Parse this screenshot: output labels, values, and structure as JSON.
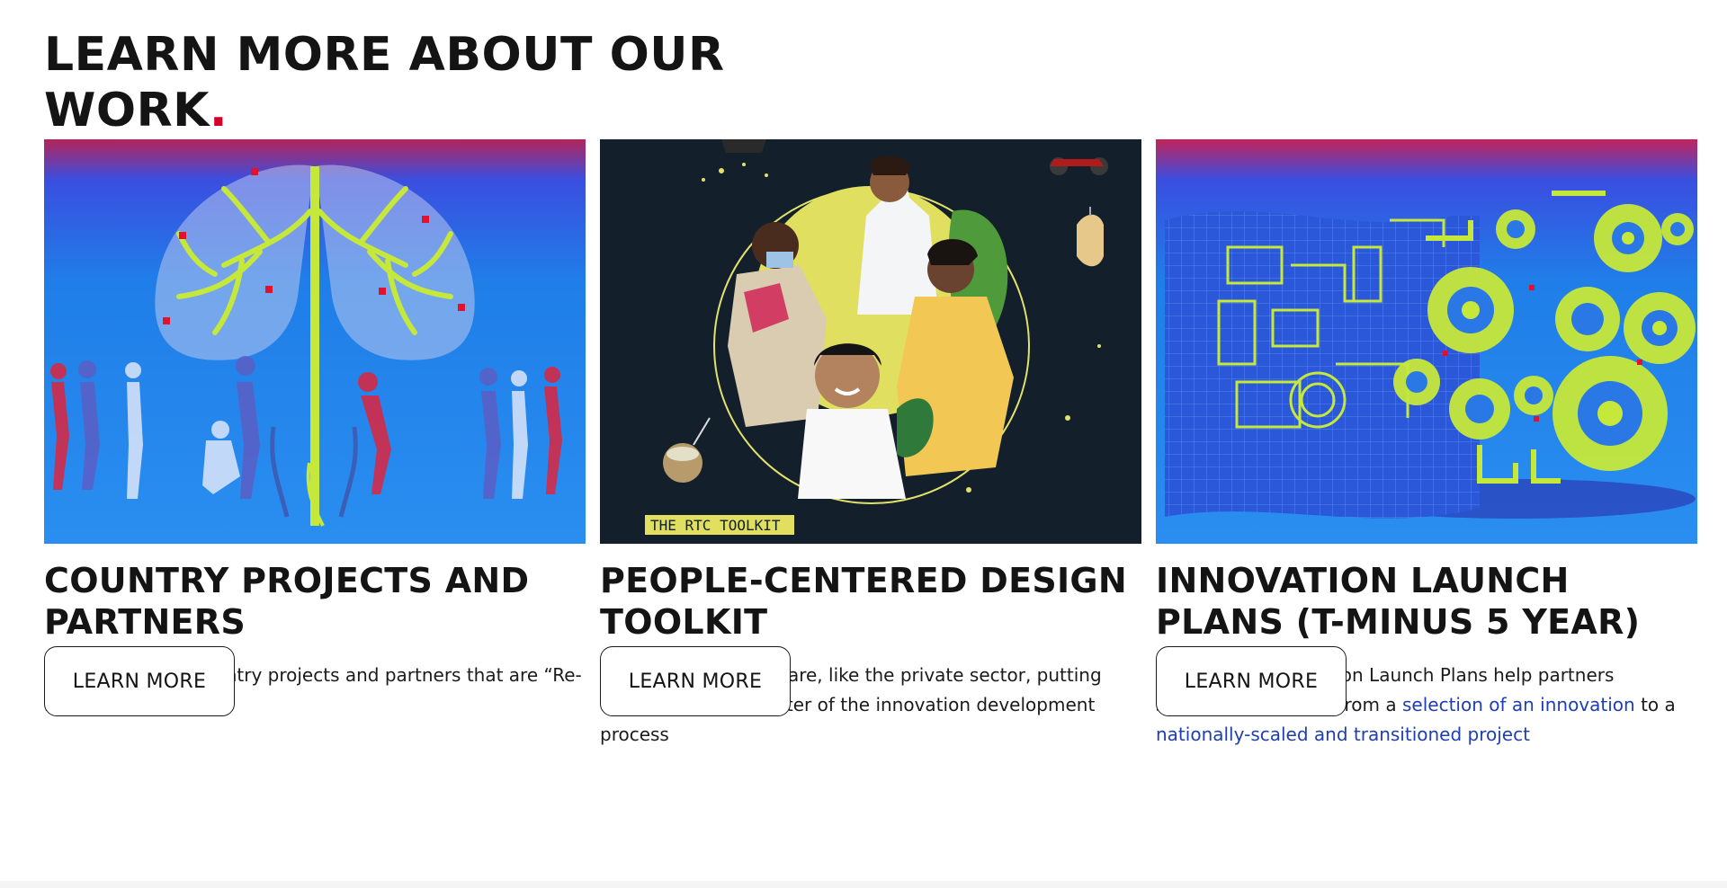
{
  "section": {
    "heading": "LEARN MORE ABOUT OUR WORK",
    "heading_dot": "."
  },
  "cards": [
    {
      "title": "COUNTRY PROJECTS AND PARTNERS",
      "description": "Learn about our country projects and partners that are “Re-imagining TB Care”",
      "button": "LEARN MORE"
    },
    {
      "title": "PEOPLE-CENTERED DESIGN TOOLKIT",
      "description": "Learn about how we are, like the private sector, putting end-users at the center of the innovation development process",
      "image_label": "THE RTC TOOLKIT",
      "button": "LEARN MORE"
    },
    {
      "title": "INNOVATION LAUNCH PLANS (T-MINUS 5 YEAR)",
      "description_parts": {
        "intro": "Our 5-stage Innovation Launch Plans help partners structure how to go from a ",
        "link1": "selection of an innovation",
        "middle": " to a ",
        "link2": "nationally-scaled and transitioned project"
      },
      "button": "LEARN MORE"
    }
  ],
  "colors": {
    "accent_red": "#d4002a",
    "link_blue": "#1f3fb0",
    "illustration_blue": "#1e7ee8",
    "illustration_lime": "#c6e83a",
    "toolkit_navy": "#13202c"
  }
}
